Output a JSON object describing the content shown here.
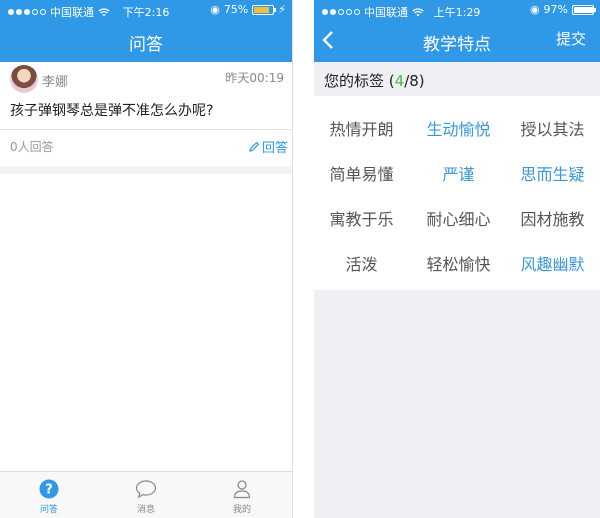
{
  "left_phone": {
    "status": {
      "carrier": "中国联通",
      "time": "下午2:16",
      "battery": "75%",
      "battery_level": 0.75
    },
    "nav": {
      "title": "问答"
    },
    "post": {
      "user": "李娜",
      "time": "昨天00:19",
      "question": "孩子弹钢琴总是弹不准怎么办呢?",
      "answers": "0人回答",
      "reply": "回答"
    },
    "tabbar": [
      {
        "label": "问答",
        "icon": "question-icon",
        "active": true
      },
      {
        "label": "消息",
        "icon": "chat-bubble-icon",
        "active": false
      },
      {
        "label": "我的",
        "icon": "person-icon",
        "active": false
      }
    ]
  },
  "right_phone": {
    "status": {
      "carrier": "中国联通",
      "time": "上午1:29",
      "battery": "97%",
      "battery_level": 0.97
    },
    "nav": {
      "title": "教学特点",
      "submit": "提交"
    },
    "tags_header": {
      "label": "您的标签",
      "open": "(",
      "count": "4",
      "total": "/8)"
    },
    "tags": [
      {
        "label": "热情开朗",
        "selected": false
      },
      {
        "label": "生动愉悦",
        "selected": true
      },
      {
        "label": "授以其法",
        "selected": false
      },
      {
        "label": "简单易懂",
        "selected": false
      },
      {
        "label": "严谨",
        "selected": true
      },
      {
        "label": "思而生疑",
        "selected": true
      },
      {
        "label": "寓教于乐",
        "selected": false
      },
      {
        "label": "耐心细心",
        "selected": false
      },
      {
        "label": "因材施教",
        "selected": false
      },
      {
        "label": "活泼",
        "selected": false
      },
      {
        "label": "轻松愉快",
        "selected": false
      },
      {
        "label": "风趣幽默",
        "selected": true
      }
    ]
  },
  "colors": {
    "accent": "#2f99e8",
    "tag_selected": "#3a97d8",
    "count_green": "#4cb94c",
    "battery_yellow": "#f3c233"
  }
}
